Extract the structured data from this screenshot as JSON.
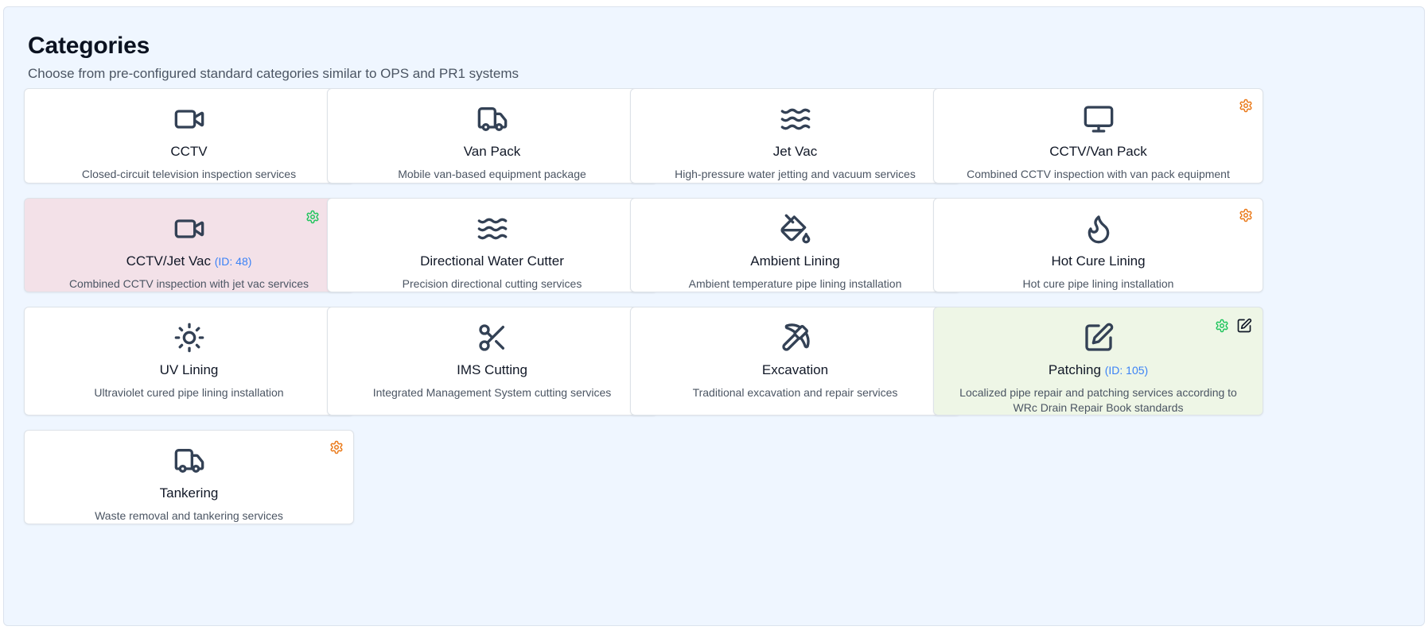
{
  "header": {
    "title": "Categories",
    "subtitle": "Choose from pre-configured standard categories similar to OPS and PR1 systems"
  },
  "colors": {
    "gear_default": "#ea7a1a",
    "gear_active": "#22c55e",
    "id_text": "#3b82f6",
    "selected_pink": "#f3e1e8",
    "selected_green": "#eef6e6",
    "icon": "#334155"
  },
  "categories": [
    {
      "name": "CCTV",
      "description": "Closed-circuit television inspection services",
      "icon": "video-camera-icon"
    },
    {
      "name": "Van Pack",
      "description": "Mobile van-based equipment package",
      "icon": "truck-icon"
    },
    {
      "name": "Jet Vac",
      "description": "High-pressure water jetting and vacuum services",
      "icon": "waves-icon"
    },
    {
      "name": "CCTV/Van Pack",
      "description": "Combined CCTV inspection with van pack equipment",
      "icon": "monitor-icon"
    },
    {
      "name": "CCTV/Jet Vac",
      "id_label": "(ID: 48)",
      "description": "Combined CCTV inspection with jet vac services",
      "icon": "video-camera-icon",
      "selected": true
    },
    {
      "name": "Directional Water Cutter",
      "description": "Precision directional cutting services",
      "icon": "waves-icon"
    },
    {
      "name": "Ambient Lining",
      "description": "Ambient temperature pipe lining installation",
      "icon": "paint-bucket-icon"
    },
    {
      "name": "Hot Cure Lining",
      "description": "Hot cure pipe lining installation",
      "icon": "flame-icon"
    },
    {
      "name": "UV Lining",
      "description": "Ultraviolet cured pipe lining installation",
      "icon": "sun-icon"
    },
    {
      "name": "IMS Cutting",
      "description": "Integrated Management System cutting services",
      "icon": "scissors-icon"
    },
    {
      "name": "Excavation",
      "description": "Traditional excavation and repair services",
      "icon": "pickaxe-icon"
    },
    {
      "name": "Patching",
      "id_label": "(ID: 105)",
      "description": "Localized pipe repair and patching services according to WRc Drain Repair Book standards",
      "icon": "pencil-square-icon",
      "selected": true
    },
    {
      "name": "Tankering",
      "description": "Waste removal and tankering services",
      "icon": "truck-icon"
    }
  ]
}
